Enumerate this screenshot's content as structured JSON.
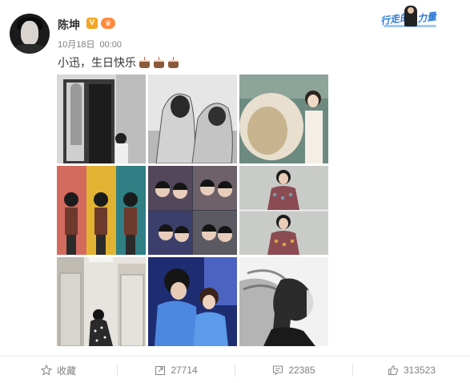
{
  "post": {
    "author": "陈坤",
    "date": "10月18日",
    "time": "00:00",
    "text": "小迅，生日快乐",
    "verified_label": "V",
    "badge_left": "行走的",
    "badge_right": "力量"
  },
  "images": [
    {
      "name": "photo-1"
    },
    {
      "name": "photo-2"
    },
    {
      "name": "photo-3"
    },
    {
      "name": "photo-4"
    },
    {
      "name": "photo-5"
    },
    {
      "name": "photo-6"
    },
    {
      "name": "photo-7"
    },
    {
      "name": "photo-8"
    },
    {
      "name": "photo-9"
    }
  ],
  "actions": {
    "favorite_label": "收藏",
    "repost_count": "27714",
    "comment_count": "22385",
    "like_count": "313523"
  },
  "colors": {
    "accent_blue": "#2f7bd8",
    "verified_orange": "#f5a623",
    "meta_gray": "#808080"
  }
}
